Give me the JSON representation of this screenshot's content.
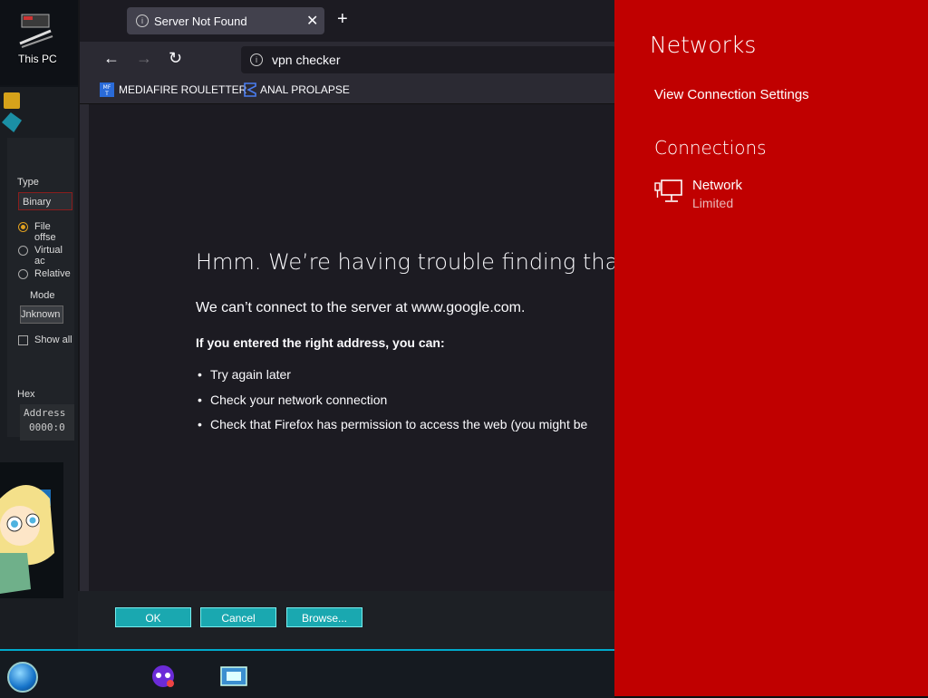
{
  "desktop": {
    "icon_label": "This PC"
  },
  "hex_dialog": {
    "type_label": "Type",
    "type_value": "Binary",
    "radio_file_offset": "File offse",
    "radio_virtual": "Virtual ac",
    "radio_relative": "Relative",
    "mode_label": "Mode",
    "mode_value": "Jnknown",
    "show_all": "Show all",
    "hex_label": "Hex",
    "hex_address": "Address",
    "hex_offset": "0000:0",
    "ok": "OK",
    "cancel": "Cancel",
    "browse": "Browse..."
  },
  "browser": {
    "tab_title": "Server Not Found",
    "url": "vpn checker",
    "bookmarks": [
      {
        "label": "MEDIAFIRE ROULETTER",
        "icon": "mediafire-icon"
      },
      {
        "label": "ANAL PROLAPSE",
        "icon": "sigma-icon"
      }
    ],
    "error": {
      "title": "Hmm. We’re having trouble finding that sit",
      "subtitle": "We can’t connect to the server at www.google.com.",
      "hint": "If you entered the right address, you can:",
      "items": [
        "Try again later",
        "Check your network connection",
        "Check that Firefox has permission to access the web (you might be"
      ]
    }
  },
  "networks_panel": {
    "title": "Networks",
    "view_settings": "View Connection Settings",
    "connections_title": "Connections",
    "network_name": "Network",
    "network_status": "Limited",
    "accent": "#c00000"
  }
}
